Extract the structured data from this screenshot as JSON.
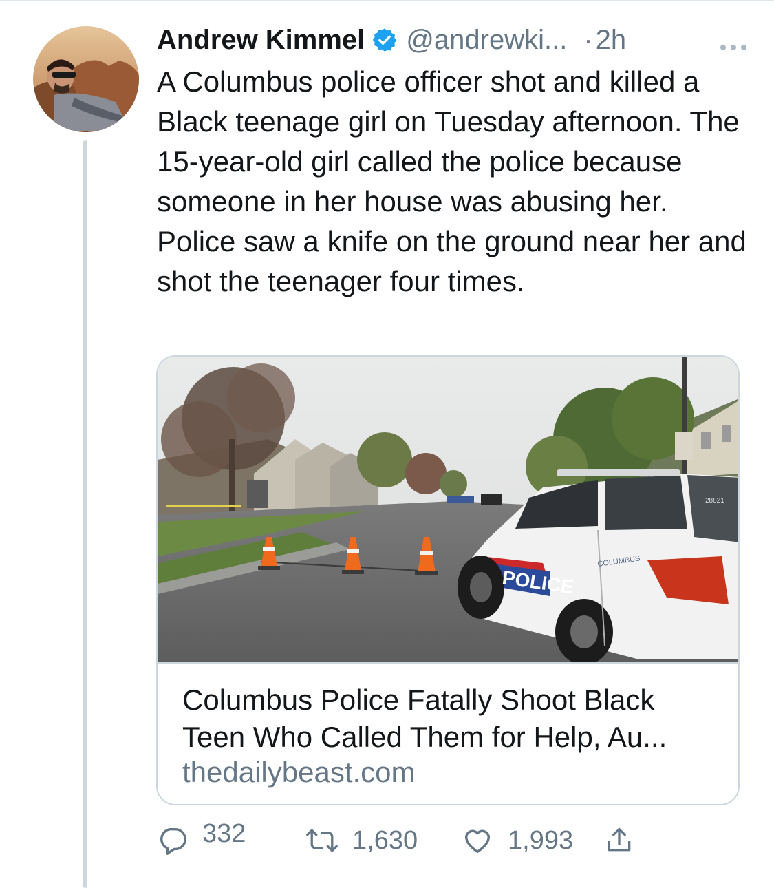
{
  "tweet": {
    "author_name": "Andrew Kimmel",
    "handle": "@andrewki...",
    "separator": "·",
    "time": "2h",
    "text": "A Columbus police officer shot and killed a Black teenage girl on Tuesday afternoon. The 15-year-old girl called the police because someone in her house was abusing her. Police saw a knife on the ground near her and shot the teenager four times."
  },
  "card": {
    "title": "Columbus Police Fatally Shoot Black Teen Who Called Them for Help, Au...",
    "domain": "thedailybeast.com",
    "image_text": {
      "vehicle_label": "POLICE",
      "city_label": "COLUMBUS",
      "unit_number": "28821"
    }
  },
  "actions": {
    "replies": "332",
    "retweets": "1,630",
    "likes": "1,993"
  },
  "icons": {
    "verified": "verified-badge-icon",
    "more": "more-options-icon",
    "reply": "reply-icon",
    "retweet": "retweet-icon",
    "like": "heart-icon",
    "share": "share-icon"
  },
  "colors": {
    "verified_blue": "#1da1f2",
    "secondary_text": "#657786",
    "primary_text": "#14171a",
    "border": "#ccd6dd"
  }
}
